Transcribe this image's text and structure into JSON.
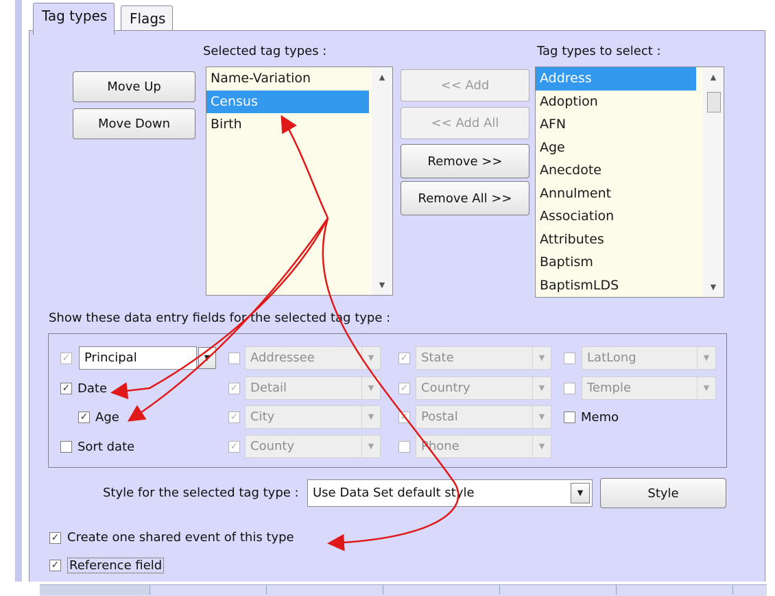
{
  "tabs": {
    "tag_types": "Tag types",
    "flags": "Flags"
  },
  "headings": {
    "selected": "Selected tag types :",
    "to_select": "Tag types to select :",
    "show_fields": "Show these data entry fields for the selected tag type :"
  },
  "buttons": {
    "move_up": "Move Up",
    "move_down": "Move Down",
    "add": "<< Add",
    "add_all": "<< Add All",
    "remove": "Remove >>",
    "remove_all": "Remove All >>",
    "style": "Style"
  },
  "selected_list": [
    "Name-Variation",
    "Census",
    "Birth"
  ],
  "selected_list_selected": "Census",
  "available_list": [
    "Address",
    "Adoption",
    "AFN",
    "Age",
    "Anecdote",
    "Annulment",
    "Association",
    "Attributes",
    "Baptism",
    "BaptismLDS"
  ],
  "available_list_selected": "Address",
  "fields": {
    "principal": "Principal",
    "date": "Date",
    "age": "Age",
    "sort_date": "Sort date",
    "addressee": "Addressee",
    "detail": "Detail",
    "city": "City",
    "county": "County",
    "state": "State",
    "country": "Country",
    "postal": "Postal",
    "phone": "Phone",
    "latlong": "LatLong",
    "temple": "Temple",
    "memo": "Memo"
  },
  "style_row": {
    "label": "Style for the selected tag type :",
    "value": "Use Data Set default style"
  },
  "options": {
    "shared_event": "Create one shared event of this type",
    "reference_field": "Reference field"
  },
  "glyphs": {
    "check": "✓",
    "drop": "▼",
    "up": "▲",
    "down": "▼"
  },
  "colors": {
    "panel": "#d8d9fb",
    "list_bg": "#fdfbea",
    "selection": "#3399ee",
    "annotation_arrow": "#e01818"
  }
}
